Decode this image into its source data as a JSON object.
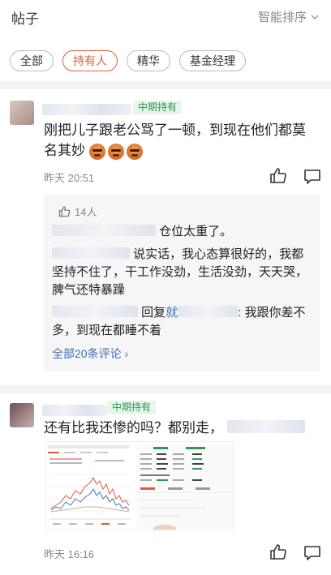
{
  "header": {
    "title": "帖子",
    "sort_label": "智能排序"
  },
  "filters": [
    "全部",
    "持有人",
    "精华",
    "基金经理"
  ],
  "post1": {
    "badge": "中期持有",
    "text": "刚把儿子跟老公骂了一顿，到现在他们都莫名其妙",
    "time": "昨天 20:51",
    "reply_likes": "14人",
    "reply1_text": "仓位太重了。",
    "reply2_text": "说实话，我心态算很好的，我都坚持不住了，干工作没劲，生活没劲，天天哭，脾气还特暴躁",
    "reply3_prefix": "回复",
    "reply3_link": "就",
    "reply3_text": ": 我跟你差不多，到现在都睡不着",
    "more_label": "全部20条评论 ›"
  },
  "post2": {
    "badge": "中期持有",
    "text": "还有比我还惨的吗？都别走，",
    "time": "昨天 16:16"
  },
  "colors": {
    "accent": "#e15c32",
    "badge_green": "#2e9a52",
    "link": "#3a6fb0"
  },
  "icons": [
    "chevron-down-icon",
    "thumbs-up-icon",
    "comment-icon"
  ]
}
